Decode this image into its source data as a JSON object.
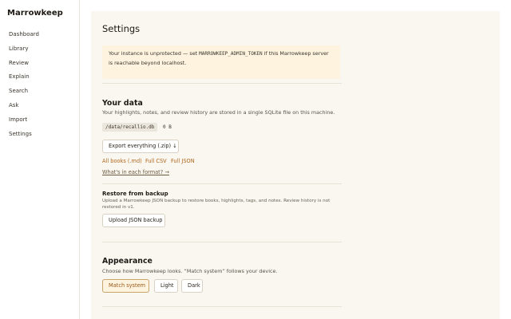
{
  "app": {
    "brand": "Marrowkeep"
  },
  "sidebar": {
    "items": [
      {
        "label": "Dashboard"
      },
      {
        "label": "Library"
      },
      {
        "label": "Review"
      },
      {
        "label": "Explain"
      },
      {
        "label": "Search"
      },
      {
        "label": "Ask"
      },
      {
        "label": "Import"
      },
      {
        "label": "Settings"
      }
    ]
  },
  "page": {
    "title": "Settings"
  },
  "warning": {
    "text_before": "Your instance is unprotected — set ",
    "code": "MARROWKEEP_ADMIN_TOKEN",
    "text_after": " if this Marrowkeep server is reachable beyond localhost."
  },
  "your_data": {
    "title": "Your data",
    "description": "Your highlights, notes, and review history are stored in a single SQLite file on this machine.",
    "db_path": "/data/recallio.db",
    "db_size": "0 B",
    "export_button": "Export everything (.zip) ↓",
    "links": [
      {
        "label": "All books (.md)"
      },
      {
        "label": "Full CSV"
      },
      {
        "label": "Full JSON"
      }
    ],
    "format_link": "What's in each format? →"
  },
  "restore": {
    "title": "Restore from backup",
    "description": "Upload a Marrowkeep JSON backup to restore books, highlights, tags, and notes. Review history is not restored in v1.",
    "upload_button": "Upload JSON backup"
  },
  "appearance": {
    "title": "Appearance",
    "description": "Choose how Marrowkeep looks. “Match system” follows your device.",
    "options": [
      {
        "label": "Match system"
      },
      {
        "label": "Light"
      },
      {
        "label": "Dark"
      }
    ],
    "selected": "Match system"
  },
  "colors": {
    "accent": "#b0661b",
    "warning_bg": "#fdf3df",
    "panel_bg": "#faf7f1"
  }
}
